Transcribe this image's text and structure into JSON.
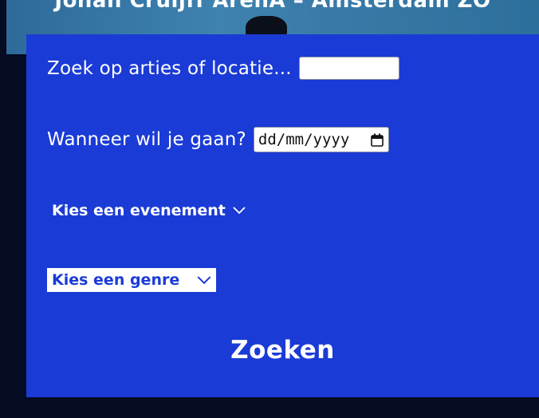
{
  "background": {
    "title": "Johan Cruijff ArenA – Amsterdam ZO"
  },
  "search": {
    "label": "Zoek op arties of locatie...",
    "value": "",
    "placeholder": ""
  },
  "date": {
    "label": "Wanneer wil je gaan?",
    "placeholder": "dd/mm/yyyy",
    "icon": "calendar-icon"
  },
  "event": {
    "label": "Kies een evenement",
    "icon": "chevron-down-icon"
  },
  "genre": {
    "selected": "Kies een genre",
    "icon": "chevron-down-icon"
  },
  "submit": {
    "label": "Zoeken"
  },
  "colors": {
    "panel": "#1a3bd6",
    "page_background": "#040b22",
    "text": "#ffffff"
  }
}
